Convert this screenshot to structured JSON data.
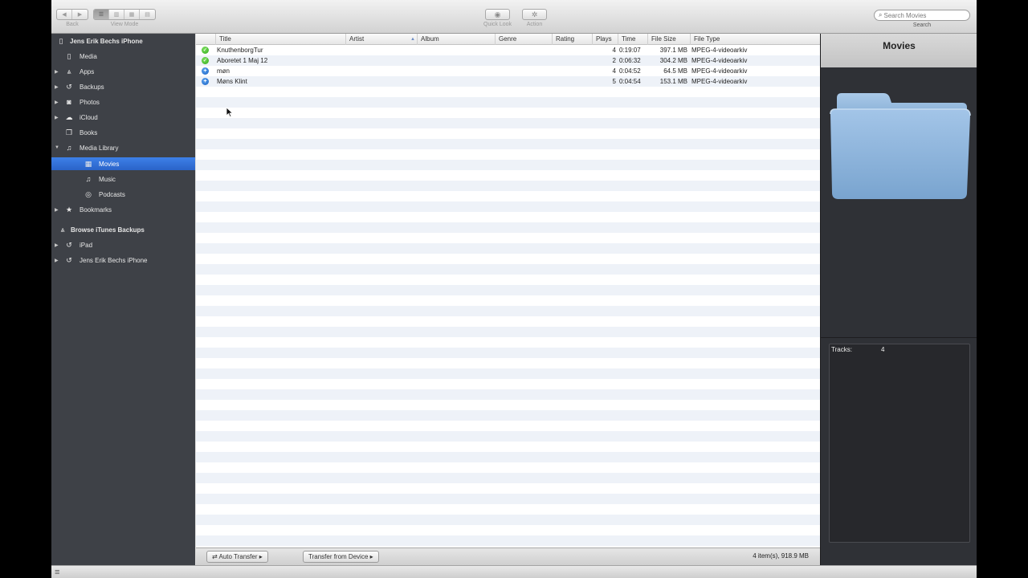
{
  "toolbar": {
    "back_label": "Back",
    "view_mode_label": "View Mode",
    "quick_look_label": "Quick Look",
    "action_label": "Action",
    "search_placeholder": "Search Movies",
    "search_label": "Search",
    "search_value": ""
  },
  "sidebar": {
    "device": "Jens Erik Bechs iPhone",
    "items": [
      {
        "label": "Media",
        "icon": "media-icon",
        "expandable": false
      },
      {
        "label": "Apps",
        "icon": "apps-icon",
        "expandable": true
      },
      {
        "label": "Backups",
        "icon": "backup-icon",
        "expandable": true
      },
      {
        "label": "Photos",
        "icon": "camera-icon",
        "expandable": true
      },
      {
        "label": "iCloud",
        "icon": "cloud-icon",
        "expandable": true
      },
      {
        "label": "Books",
        "icon": "book-icon",
        "expandable": false
      },
      {
        "label": "Media Library",
        "icon": "music-note-icon",
        "expandable": true,
        "expanded": true
      }
    ],
    "library_items": [
      {
        "label": "Movies",
        "icon": "film-icon",
        "selected": true
      },
      {
        "label": "Music",
        "icon": "music-note-icon",
        "selected": false
      },
      {
        "label": "Podcasts",
        "icon": "podcast-icon",
        "selected": false
      }
    ],
    "bookmarks": "Bookmarks",
    "backups_header": "Browse iTunes Backups",
    "backup_items": [
      {
        "label": "iPad",
        "icon": "backup-icon"
      },
      {
        "label": "Jens Erik Bechs iPhone",
        "icon": "backup-icon"
      }
    ]
  },
  "table": {
    "columns": {
      "title": "Title",
      "artist": "Artist",
      "album": "Album",
      "genre": "Genre",
      "rating": "Rating",
      "plays": "Plays",
      "time": "Time",
      "file_size": "File Size",
      "file_type": "File Type"
    },
    "rows": [
      {
        "status": "on-device",
        "title": "KnuthenborgTur",
        "plays": "4",
        "time": "0:19:07",
        "size": "397.1 MB",
        "type": "MPEG-4-videoarkiv"
      },
      {
        "status": "on-device",
        "title": "Aboretet 1 Maj 12",
        "plays": "2",
        "time": "0:06:32",
        "size": "304.2 MB",
        "type": "MPEG-4-videoarkiv"
      },
      {
        "status": "add",
        "title": "møn",
        "plays": "4",
        "time": "0:04:52",
        "size": "64.5 MB",
        "type": "MPEG-4-videoarkiv"
      },
      {
        "status": "add",
        "title": "Møns Klint",
        "plays": "5",
        "time": "0:04:54",
        "size": "153.1 MB",
        "type": "MPEG-4-videoarkiv"
      }
    ]
  },
  "bottombar": {
    "auto_transfer": "Auto Transfer",
    "transfer_from_device": "Transfer from Device",
    "status": "4 item(s), 918.9 MB"
  },
  "rightpanel": {
    "title": "Movies",
    "tracks_label": "Tracks:",
    "tracks_value": "4"
  },
  "colors": {
    "sidebar_bg": "#3e4147",
    "selection": "#2f6fd8",
    "folder": "#8fb9e0"
  }
}
